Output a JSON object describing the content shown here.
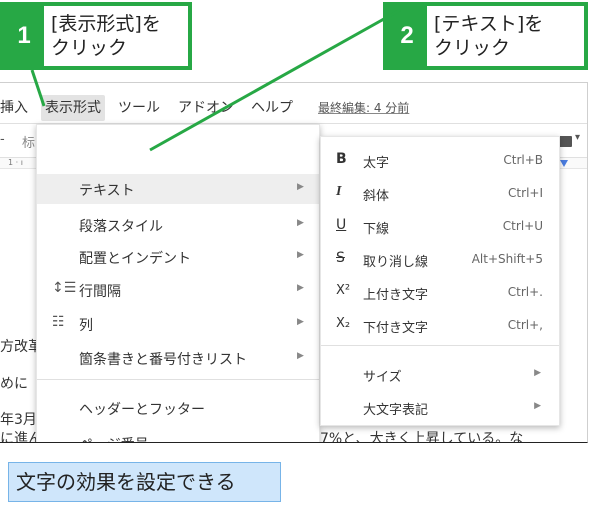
{
  "callouts": [
    {
      "number": "1",
      "text": "[表示形式]を\nクリック"
    },
    {
      "number": "2",
      "text": "[テキスト]を\nクリック"
    }
  ],
  "menubar": {
    "insert": "挿入",
    "format": "表示形式",
    "tools": "ツール",
    "addons": "アドオン",
    "help": "ヘルプ",
    "last_edit": "最終編集: 4 分前"
  },
  "toolbar": {
    "left_glyph_1": "-",
    "left_glyph_2": "标",
    "ruler_mark": "1 · ı"
  },
  "format_menu": {
    "items": [
      {
        "label": "テキスト",
        "icon": "",
        "has_submenu": true,
        "highlighted": true
      },
      {
        "label": "段落スタイル",
        "icon": "",
        "has_submenu": true
      },
      {
        "label": "配置とインデント",
        "icon": "",
        "has_submenu": true
      },
      {
        "label": "行間隔",
        "icon": "line-spacing-icon",
        "icon_glyph": "↕☰",
        "has_submenu": true
      },
      {
        "label": "列",
        "icon": "columns-icon",
        "icon_glyph": "☷",
        "has_submenu": true
      },
      {
        "label": "箇条書きと番号付きリスト",
        "icon": "",
        "has_submenu": true
      },
      {
        "label": "ヘッダーとフッター",
        "icon": "",
        "has_submenu": false
      },
      {
        "label": "ページ番号",
        "icon": "",
        "has_submenu": false
      }
    ]
  },
  "text_submenu": {
    "items": [
      {
        "icon": "bold-icon",
        "icon_glyph": "B",
        "label": "太字",
        "shortcut": "Ctrl+B"
      },
      {
        "icon": "italic-icon",
        "icon_glyph": "I",
        "label": "斜体",
        "shortcut": "Ctrl+I"
      },
      {
        "icon": "underline-icon",
        "icon_glyph": "U",
        "label": "下線",
        "shortcut": "Ctrl+U"
      },
      {
        "icon": "strikethrough-icon",
        "icon_glyph": "S",
        "label": "取り消し線",
        "shortcut": "Alt+Shift+5"
      },
      {
        "icon": "superscript-icon",
        "icon_glyph": "X²",
        "label": "上付き文字",
        "shortcut": "Ctrl+."
      },
      {
        "icon": "subscript-icon",
        "icon_glyph": "X₂",
        "label": "下付き文字",
        "shortcut": "Ctrl+,"
      },
      {
        "icon": "",
        "label": "サイズ",
        "shortcut": "",
        "has_submenu": true
      },
      {
        "icon": "",
        "label": "大文字表記",
        "shortcut": "",
        "has_submenu": true
      }
    ]
  },
  "document_fragments": {
    "line1": "方改革",
    "line2": "めに",
    "line3": "年3月",
    "line4": "に進ん",
    "right": "7%と、大きく上昇している。な"
  },
  "caption": "文字の効果を設定できる",
  "colors": {
    "callout_green": "#27a845",
    "caption_bg": "#cfe6fb",
    "caption_border": "#77b4e8",
    "highlight": "#eeeeee"
  }
}
